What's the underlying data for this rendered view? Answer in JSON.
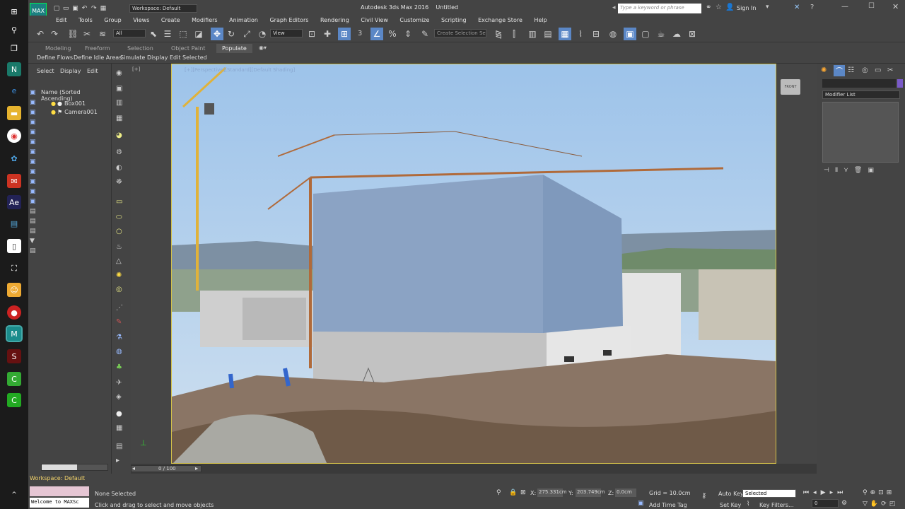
{
  "window": {
    "title": "Autodesk 3ds Max 2016",
    "document": "Untitled",
    "workspace": "Workspace: Default",
    "search_placeholder": "Type a keyword or phrase",
    "sign_in": "Sign In"
  },
  "menu": [
    "Edit",
    "Tools",
    "Group",
    "Views",
    "Create",
    "Modifiers",
    "Animation",
    "Graph Editors",
    "Rendering",
    "Civil View",
    "Customize",
    "Scripting",
    "Exchange Store",
    "Help"
  ],
  "toolbar": {
    "selection_filter": "All",
    "view_label": "View",
    "selection_set": "Create Selection Se",
    "snaps": "3"
  },
  "ribbon": {
    "tabs": [
      "Modeling",
      "Freeform",
      "Selection",
      "Object Paint",
      "Populate"
    ],
    "active_tab": "Populate",
    "items": [
      "Define Flows",
      "Define Idle Areas",
      "Simulate",
      "Display",
      "Edit Selected"
    ]
  },
  "scene_explorer": {
    "tabs": [
      "Select",
      "Display",
      "Edit"
    ],
    "column_header": "Name (Sorted Ascending)",
    "items": [
      "Box001",
      "Camera001"
    ]
  },
  "viewport": {
    "label": "[+][Perspective][Standard][Default Shading]"
  },
  "command_panel": {
    "modifier_list": "Modifier List"
  },
  "timeline": {
    "frame_counter": "0 / 100",
    "ticks": [
      "0",
      "5",
      "10",
      "15",
      "20",
      "25",
      "30",
      "35",
      "40",
      "45",
      "50",
      "55",
      "60",
      "65",
      "70",
      "75",
      "80",
      "85",
      "90",
      "95",
      "100"
    ]
  },
  "status": {
    "workspace": "Workspace: Default",
    "script_listener": "Welcome to MAXSc",
    "selection": "None Selected",
    "prompt": "Click and drag to select and move objects",
    "x_label": "X:",
    "x_value": "275.331cm",
    "y_label": "Y:",
    "y_value": "203.749cm",
    "z_label": "Z:",
    "z_value": "0.0cm",
    "grid": "Grid = 10.0cm",
    "add_time_tag": "Add Time Tag",
    "auto_key": "Auto Key",
    "set_key": "Set Key",
    "key_mode": "Selected",
    "key_filters": "Key Filters...",
    "current_frame": "0"
  }
}
